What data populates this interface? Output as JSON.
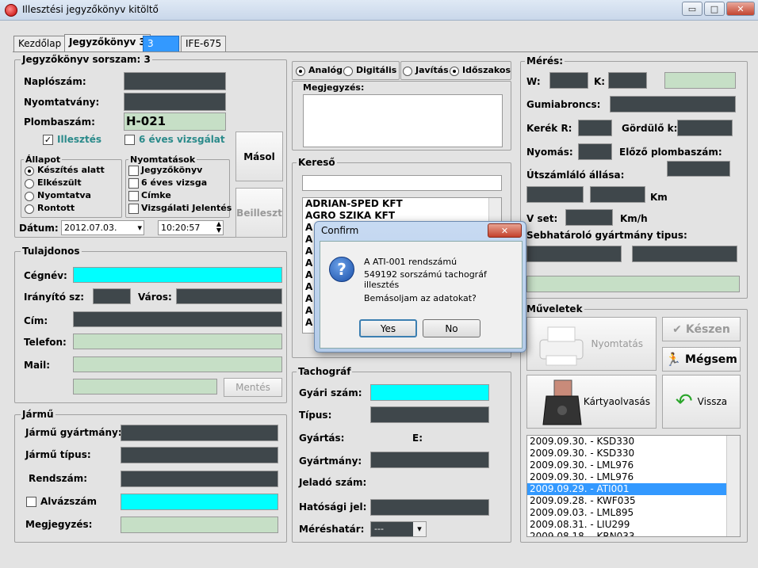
{
  "window": {
    "title": "Illesztési jegyzőkönyv kitöltő",
    "minimize": "▭",
    "maximize": "□",
    "close": "✕"
  },
  "tabs": [
    {
      "label": "Kezdőlap"
    },
    {
      "label": "Jegyzőkönyv 3"
    },
    {
      "label": "3"
    },
    {
      "label": "IFE-675"
    }
  ],
  "form": {
    "header": "Jegyzőkönyv sorszam: 3",
    "naplo_label": "Naplószám:",
    "nyomtatvany_label": "Nyomtatvány:",
    "plomba_label": "Plombaszám:",
    "plomba_value": "H-021",
    "illesztes_label": "Illesztés",
    "hatev_label": "6 éves vizsgálat",
    "allapot_title": "Állapot",
    "allapot": [
      "Készítés alatt",
      "Elkészült",
      "Nyomtatva",
      "Rontott"
    ],
    "nyomtatasok_title": "Nyomtatások",
    "nyomtatasok": [
      "Jegyzőkönyv",
      "6 éves vizsga",
      "Címke",
      "Vizsgálati Jelentés"
    ],
    "masol": "Másol",
    "beilleszt": "Beilleszt",
    "datum_label": "Dátum:",
    "datum_value": "2012.07.03.",
    "time_value": "10:20:57"
  },
  "tulajdonos": {
    "title": "Tulajdonos",
    "cegnev": "Cégnév:",
    "iranyito": "Irányító sz:",
    "varos": "Város:",
    "cim": "Cím:",
    "telefon": "Telefon:",
    "mail": "Mail:",
    "mentes": "Mentés"
  },
  "jarmu": {
    "title": "Jármű",
    "gyartmany": "Jármű gyártmány:",
    "tipus": "Jármű típus:",
    "rendszam": "Rendszám:",
    "alvazszam": "Alvázszám",
    "megjegyzes": "Megjegyzés:"
  },
  "options": {
    "analog": "Analóg",
    "digitalis": "Digitális",
    "javitas": "Javítás",
    "idoszakos": "Időszakos",
    "megjegyzes": "Megjegyzés:"
  },
  "kereso": {
    "title": "Kereső",
    "items": [
      "ADRIAN-SPED KFT",
      "AGRO SZIKA KFT",
      "A",
      "A",
      "A",
      "A",
      "A",
      "A",
      "A",
      "A",
      "A"
    ]
  },
  "tachograf": {
    "title": "Tachográf",
    "gyari": "Gyári szám:",
    "tipus": "Típus:",
    "gyartas": "Gyártás:",
    "e": "E:",
    "gyartmany": "Gyártmány:",
    "jelado": "Jeladó szám:",
    "hatosagi": "Hatósági jel:",
    "mereshatar": "Méréshatár:",
    "mereshatar_value": "---"
  },
  "meres": {
    "title": "Mérés:",
    "w": "W:",
    "k": "K:",
    "gumi": "Gumiabroncs:",
    "kerek": "Kerék R:",
    "gordulo": "Gördülő k:",
    "nyomas": "Nyomás:",
    "elozo": "Előző plombaszám:",
    "utszamlalo": "Útszámláló állása:",
    "km": "Km",
    "vset": "V set:",
    "kmh": "Km/h",
    "sebhatarolo": "Sebhatároló gyártmány  tipus:"
  },
  "muveletek": {
    "title": "Műveletek",
    "nyomtatas": "Nyomtatás",
    "keszen": "Készen",
    "megsem": "Mégsem",
    "kartya": "Kártyaolvasás",
    "vissza": "Vissza",
    "history": [
      "2009.09.30.  -  KSD330",
      "2009.09.30.  -  KSD330",
      "2009.09.30.  -  LML976",
      "2009.09.30.  -  LML976",
      "2009.09.29.  -  ATI001",
      "2009.09.28.  -  KWF035",
      "2009.09.03.  -  LML895",
      "2009.08.31.  -  LIU299",
      "2009.08.18.  -  KRN033"
    ]
  },
  "dialog": {
    "title": "Confirm",
    "line1": "A ATI-001 rendszámú",
    "line2": "549192 sorszámú tachográf illesztés",
    "question": "Bemásoljam az adatokat?",
    "yes": "Yes",
    "no": "No"
  },
  "colors": {
    "dark_field": "#3f474b",
    "green_field": "#c6dfc6",
    "cyan_field": "#00ffff",
    "selection": "#3399ff"
  }
}
